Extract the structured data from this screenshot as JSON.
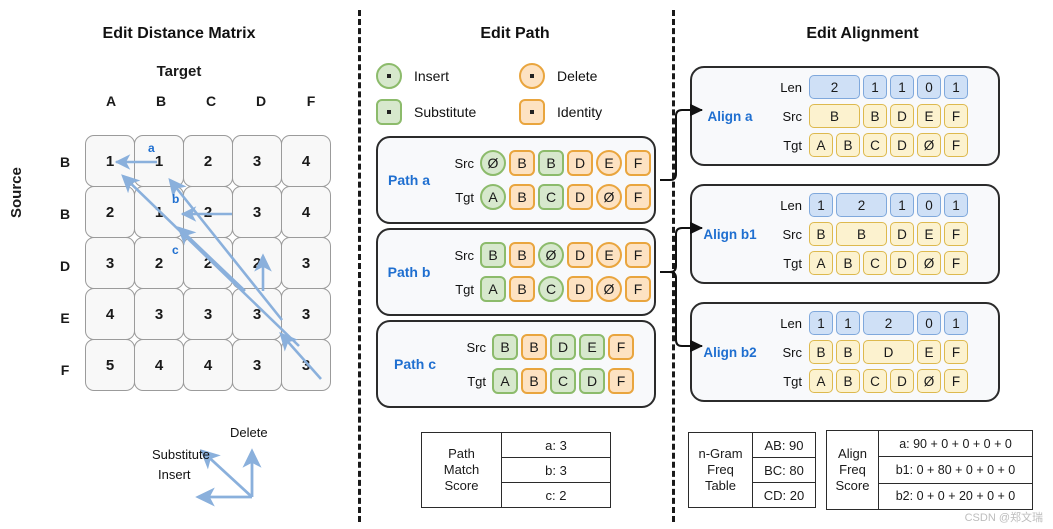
{
  "panels": {
    "matrix_title": "Edit Distance Matrix",
    "path_title": "Edit Path",
    "alignment_title": "Edit Alignment"
  },
  "matrix": {
    "target_label": "Target",
    "source_label": "Source",
    "columns": [
      "A",
      "B",
      "C",
      "D",
      "F"
    ],
    "rows": [
      "B",
      "B",
      "D",
      "E",
      "F"
    ],
    "values": [
      [
        1,
        1,
        2,
        3,
        4
      ],
      [
        2,
        1,
        2,
        3,
        4
      ],
      [
        3,
        2,
        2,
        2,
        3
      ],
      [
        4,
        3,
        3,
        3,
        3
      ],
      [
        5,
        4,
        4,
        3,
        3
      ]
    ],
    "path_labels": [
      "a",
      "b",
      "c"
    ],
    "arrow_legend": {
      "substitute": "Substitute",
      "delete": "Delete",
      "insert": "Insert"
    }
  },
  "legend": {
    "items": [
      {
        "label": "Insert",
        "shape": "circle",
        "color": "green"
      },
      {
        "label": "Delete",
        "shape": "circle",
        "color": "orange"
      },
      {
        "label": "Substitute",
        "shape": "square",
        "color": "green"
      },
      {
        "label": "Identity",
        "shape": "square",
        "color": "orange"
      }
    ]
  },
  "paths": [
    {
      "name": "Path a",
      "src_label": "Src",
      "tgt_label": "Tgt",
      "src": [
        {
          "t": "Ø",
          "c": "g",
          "s": "c"
        },
        {
          "t": "B",
          "c": "o",
          "s": "s"
        },
        {
          "t": "B",
          "c": "g",
          "s": "s"
        },
        {
          "t": "D",
          "c": "o",
          "s": "s"
        },
        {
          "t": "E",
          "c": "o",
          "s": "c"
        },
        {
          "t": "F",
          "c": "o",
          "s": "s"
        }
      ],
      "tgt": [
        {
          "t": "A",
          "c": "g",
          "s": "c"
        },
        {
          "t": "B",
          "c": "o",
          "s": "s"
        },
        {
          "t": "C",
          "c": "g",
          "s": "s"
        },
        {
          "t": "D",
          "c": "o",
          "s": "s"
        },
        {
          "t": "Ø",
          "c": "o",
          "s": "c"
        },
        {
          "t": "F",
          "c": "o",
          "s": "s"
        }
      ]
    },
    {
      "name": "Path b",
      "src_label": "Src",
      "tgt_label": "Tgt",
      "src": [
        {
          "t": "B",
          "c": "g",
          "s": "s"
        },
        {
          "t": "B",
          "c": "o",
          "s": "s"
        },
        {
          "t": "Ø",
          "c": "g",
          "s": "c"
        },
        {
          "t": "D",
          "c": "o",
          "s": "s"
        },
        {
          "t": "E",
          "c": "o",
          "s": "c"
        },
        {
          "t": "F",
          "c": "o",
          "s": "s"
        }
      ],
      "tgt": [
        {
          "t": "A",
          "c": "g",
          "s": "s"
        },
        {
          "t": "B",
          "c": "o",
          "s": "s"
        },
        {
          "t": "C",
          "c": "g",
          "s": "c"
        },
        {
          "t": "D",
          "c": "o",
          "s": "s"
        },
        {
          "t": "Ø",
          "c": "o",
          "s": "c"
        },
        {
          "t": "F",
          "c": "o",
          "s": "s"
        }
      ]
    },
    {
      "name": "Path c",
      "src_label": "Src",
      "tgt_label": "Tgt",
      "src": [
        {
          "t": "B",
          "c": "g",
          "s": "s"
        },
        {
          "t": "B",
          "c": "o",
          "s": "s"
        },
        {
          "t": "D",
          "c": "g",
          "s": "s"
        },
        {
          "t": "E",
          "c": "g",
          "s": "s"
        },
        {
          "t": "F",
          "c": "o",
          "s": "s"
        }
      ],
      "tgt": [
        {
          "t": "A",
          "c": "g",
          "s": "s"
        },
        {
          "t": "B",
          "c": "o",
          "s": "s"
        },
        {
          "t": "C",
          "c": "g",
          "s": "s"
        },
        {
          "t": "D",
          "c": "g",
          "s": "s"
        },
        {
          "t": "F",
          "c": "o",
          "s": "s"
        }
      ]
    }
  ],
  "path_match_score": {
    "title_lines": [
      "Path",
      "Match",
      "Score"
    ],
    "rows": [
      "a: 3",
      "b: 3",
      "c: 2"
    ]
  },
  "alignments": [
    {
      "name": "Align a",
      "len_label": "Len",
      "src_label": "Src",
      "tgt_label": "Tgt",
      "len": [
        {
          "t": "2",
          "w": 2
        },
        {
          "t": "1",
          "w": 1
        },
        {
          "t": "1",
          "w": 1
        },
        {
          "t": "0",
          "w": 1
        },
        {
          "t": "1",
          "w": 1
        }
      ],
      "src": [
        {
          "t": "B",
          "w": 2
        },
        {
          "t": "B",
          "w": 1
        },
        {
          "t": "D",
          "w": 1
        },
        {
          "t": "E",
          "w": 1
        },
        {
          "t": "F",
          "w": 1
        }
      ],
      "tgt": [
        {
          "t": "A",
          "w": 1
        },
        {
          "t": "B",
          "w": 1
        },
        {
          "t": "C",
          "w": 1
        },
        {
          "t": "D",
          "w": 1
        },
        {
          "t": "Ø",
          "w": 1
        },
        {
          "t": "F",
          "w": 1
        }
      ]
    },
    {
      "name": "Align b1",
      "len_label": "Len",
      "src_label": "Src",
      "tgt_label": "Tgt",
      "len": [
        {
          "t": "1",
          "w": 1
        },
        {
          "t": "2",
          "w": 2
        },
        {
          "t": "1",
          "w": 1
        },
        {
          "t": "0",
          "w": 1
        },
        {
          "t": "1",
          "w": 1
        }
      ],
      "src": [
        {
          "t": "B",
          "w": 1
        },
        {
          "t": "B",
          "w": 2
        },
        {
          "t": "D",
          "w": 1
        },
        {
          "t": "E",
          "w": 1
        },
        {
          "t": "F",
          "w": 1
        }
      ],
      "tgt": [
        {
          "t": "A",
          "w": 1
        },
        {
          "t": "B",
          "w": 1
        },
        {
          "t": "C",
          "w": 1
        },
        {
          "t": "D",
          "w": 1
        },
        {
          "t": "Ø",
          "w": 1
        },
        {
          "t": "F",
          "w": 1
        }
      ]
    },
    {
      "name": "Align b2",
      "len_label": "Len",
      "src_label": "Src",
      "tgt_label": "Tgt",
      "len": [
        {
          "t": "1",
          "w": 1
        },
        {
          "t": "1",
          "w": 1
        },
        {
          "t": "2",
          "w": 2
        },
        {
          "t": "0",
          "w": 1
        },
        {
          "t": "1",
          "w": 1
        }
      ],
      "src": [
        {
          "t": "B",
          "w": 1
        },
        {
          "t": "B",
          "w": 1
        },
        {
          "t": "D",
          "w": 2
        },
        {
          "t": "E",
          "w": 1
        },
        {
          "t": "F",
          "w": 1
        }
      ],
      "tgt": [
        {
          "t": "A",
          "w": 1
        },
        {
          "t": "B",
          "w": 1
        },
        {
          "t": "C",
          "w": 1
        },
        {
          "t": "D",
          "w": 1
        },
        {
          "t": "Ø",
          "w": 1
        },
        {
          "t": "F",
          "w": 1
        }
      ]
    }
  ],
  "ngram_freq_table": {
    "title_lines": [
      "n-Gram",
      "Freq",
      "Table"
    ],
    "rows": [
      "AB: 90",
      "BC: 80",
      "CD: 20"
    ]
  },
  "align_freq_score": {
    "title_lines": [
      "Align",
      "Freq",
      "Score"
    ],
    "rows": [
      "a: 90 + 0 + 0 + 0 + 0",
      "b1: 0 + 80 + 0 + 0 + 0",
      "b2: 0 + 0 + 20 + 0 + 0"
    ]
  },
  "watermark": "CSDN @郑文瑞",
  "colors": {
    "accent_blue": "#1f6fd0",
    "arrow_blue": "#8ab0dc",
    "green_fill": "#d7e8cd",
    "green_border": "#8cbb6b",
    "orange_fill": "#fde2c2",
    "orange_border": "#e9a53e",
    "blue_fill": "#cfe0f6",
    "blue_border": "#7fa8dc",
    "yellow_fill": "#fcf2cf",
    "yellow_border": "#ddb94e"
  }
}
